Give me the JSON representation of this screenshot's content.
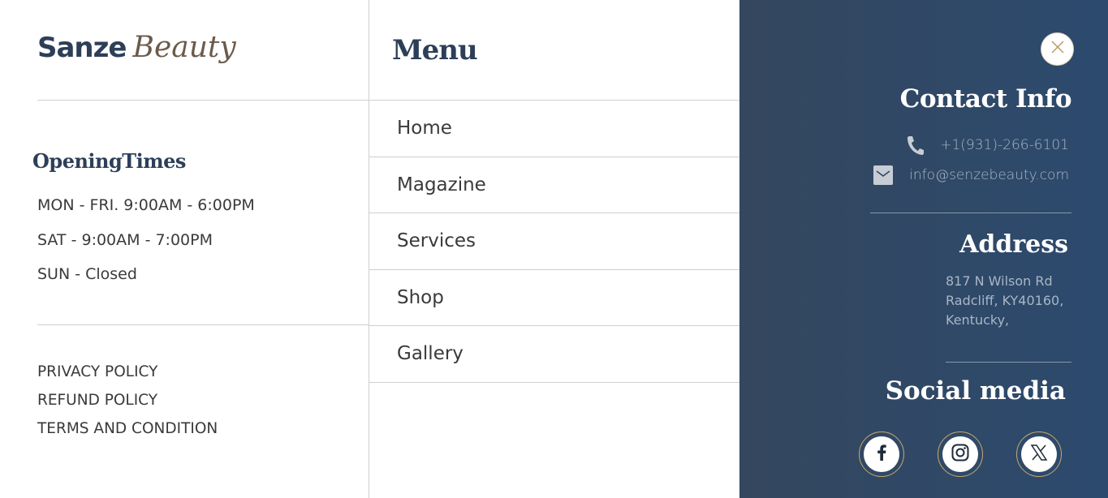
{
  "brand": {
    "name_part1": "Sanze",
    "name_part2": "Beauty"
  },
  "opening": {
    "title": "OpeningTimes",
    "hours": [
      "MON - FRI. 9:00AM - 6:00PM",
      "SAT - 9:00AM - 7:00PM",
      "SUN - Closed"
    ]
  },
  "policies": [
    "PRIVACY POLICY",
    "REFUND POLICY",
    "TERMS AND CONDITION"
  ],
  "menu": {
    "title": "Menu",
    "items": [
      "Home",
      "Magazine",
      "Services",
      "Shop",
      "Gallery"
    ]
  },
  "contact": {
    "title": "Contact Info",
    "phone": "+1(931)-266-6101",
    "email": "info@senzebeauty.com",
    "phone_icon": "phone-icon",
    "email_icon": "envelope-icon"
  },
  "address": {
    "title": "Address",
    "text": "817 N Wilson Rd Radcliff, KY40160, Kentucky,"
  },
  "social": {
    "title": "Social media",
    "icons": [
      "facebook-icon",
      "instagram-icon",
      "x-icon"
    ]
  },
  "colors": {
    "navy": "#2d3f58",
    "panel_bg": "#2c4a6e",
    "accent_gold": "#c9a86a",
    "muted_text": "#a9b6c6"
  }
}
